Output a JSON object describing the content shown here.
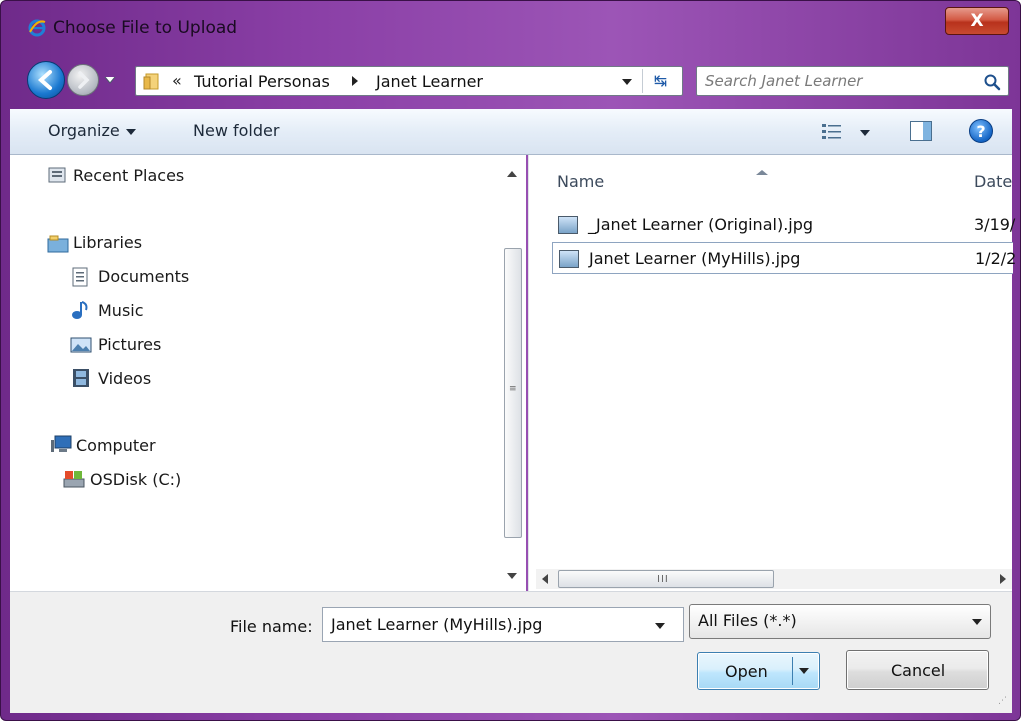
{
  "window": {
    "title": "Choose File to Upload",
    "close_label": "X"
  },
  "address": {
    "chevron": "«",
    "crumbs": [
      "Tutorial Personas",
      "Janet Learner"
    ],
    "refresh_glyph": "↹"
  },
  "search": {
    "placeholder": "Search Janet Learner"
  },
  "toolbar": {
    "organize": "Organize",
    "new_folder": "New folder",
    "help": "?"
  },
  "nav": {
    "items": [
      {
        "label": "Recent Places",
        "icon": "recent-places-icon"
      },
      {
        "label": "Libraries",
        "icon": "libraries-icon"
      },
      {
        "label": "Documents",
        "icon": "documents-icon"
      },
      {
        "label": "Music",
        "icon": "music-icon"
      },
      {
        "label": "Pictures",
        "icon": "pictures-icon"
      },
      {
        "label": "Videos",
        "icon": "videos-icon"
      },
      {
        "label": "Computer",
        "icon": "computer-icon"
      },
      {
        "label": "OSDisk (C:)",
        "icon": "drive-icon"
      }
    ]
  },
  "files": {
    "columns": [
      "Name",
      "Date"
    ],
    "rows": [
      {
        "name": "_Janet Learner (Original).jpg",
        "date": "3/19/"
      },
      {
        "name": "Janet Learner (MyHills).jpg",
        "date": "1/2/2"
      }
    ],
    "selected_index": 1
  },
  "hscroll": {
    "grip": "III"
  },
  "bottom": {
    "file_name_label": "File name:",
    "file_name_value": "Janet Learner (MyHills).jpg",
    "file_type_value": "All Files (*.*)",
    "open_label": "Open",
    "cancel_label": "Cancel"
  }
}
